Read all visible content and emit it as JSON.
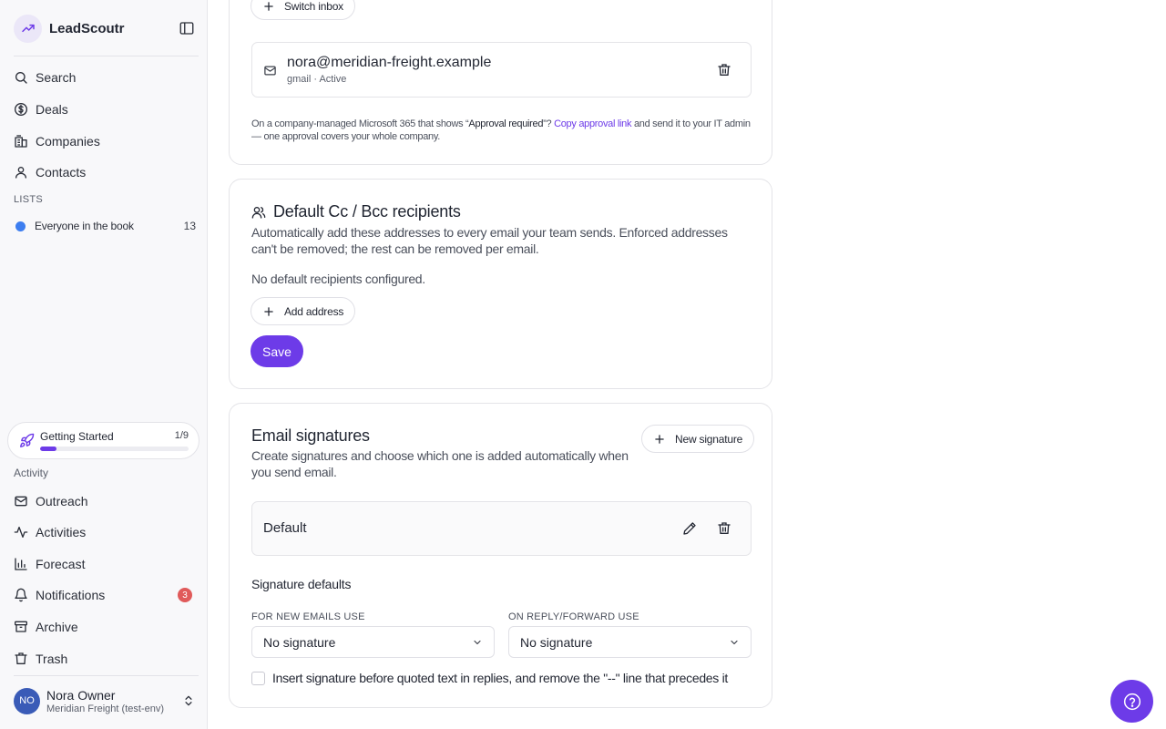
{
  "app": {
    "name": "LeadScoutr"
  },
  "nav": {
    "main": [
      {
        "label": "Search",
        "icon": "search-icon"
      },
      {
        "label": "Deals",
        "icon": "dollar-icon"
      },
      {
        "label": "Companies",
        "icon": "building-icon"
      },
      {
        "label": "Contacts",
        "icon": "user-icon"
      }
    ],
    "lists_label": "LISTS",
    "lists": [
      {
        "label": "Everyone in the book",
        "count": "13"
      }
    ],
    "activity_label": "Activity",
    "activity": [
      {
        "label": "Outreach",
        "icon": "mail-icon"
      },
      {
        "label": "Activities",
        "icon": "activity-icon"
      },
      {
        "label": "Forecast",
        "icon": "bar-chart-icon"
      },
      {
        "label": "Notifications",
        "icon": "bell-icon",
        "badge": "3"
      },
      {
        "label": "Archive",
        "icon": "archive-icon"
      },
      {
        "label": "Trash",
        "icon": "trash-icon"
      }
    ]
  },
  "getting_started": {
    "title": "Getting Started",
    "count": "1/9",
    "progress": 0.1111
  },
  "user": {
    "initials": "NO",
    "name": "Nora Owner",
    "org": "Meridian Freight (test-env)"
  },
  "inbox": {
    "switch_label": "Switch inbox",
    "email": "nora@meridian-freight.example",
    "meta": "gmail · Active",
    "note_prefix": "On a company-managed Microsoft 365 that shows “",
    "note_strong": "Approval required",
    "note_mid": "”? ",
    "note_link": "Copy approval link",
    "note_suffix": " and send it to your IT admin — one approval covers your whole company."
  },
  "cc_bcc": {
    "title": "Default Cc / Bcc recipients",
    "description": "Automatically add these addresses to every email your team sends. Enforced addresses can't be removed; the rest can be removed per email.",
    "empty_text": "No default recipients configured.",
    "add_label": "Add address",
    "save_label": "Save"
  },
  "signatures": {
    "title": "Email signatures",
    "description": "Create signatures and choose which one is added automatically when you send email.",
    "new_label": "New signature",
    "items": [
      {
        "name": "Default"
      }
    ],
    "defaults_heading": "Signature defaults",
    "new_emails_label": "FOR NEW EMAILS USE",
    "new_emails_value": "No signature",
    "reply_label": "ON REPLY/FORWARD USE",
    "reply_value": "No signature",
    "checkbox_label": "Insert signature before quoted text in replies, and remove the \"--\" line that precedes it"
  },
  "colors": {
    "accent": "#6d3be8",
    "badge": "#e05a5a",
    "list_dot": "#3d7ef0",
    "avatar": "#3a5bb7"
  }
}
